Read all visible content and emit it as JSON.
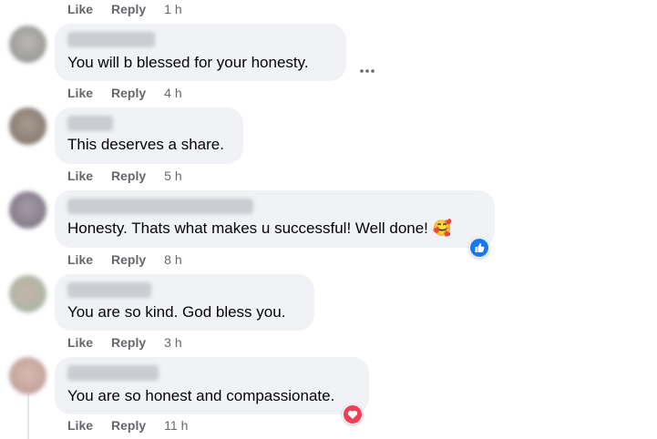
{
  "colors": {
    "bubble_bg": "#f0f2f5",
    "meta_text": "#65676b",
    "body_text": "#050505",
    "like_blue": "#1877f2",
    "love_red": "#f33e58"
  },
  "top_actions": {
    "like": "Like",
    "reply": "Reply",
    "time": "1 h"
  },
  "comments": [
    {
      "text": "You will b blessed for your honesty.",
      "like": "Like",
      "reply": "Reply",
      "time": "4 h",
      "reaction": null
    },
    {
      "text": "This deserves a share.",
      "like": "Like",
      "reply": "Reply",
      "time": "5 h",
      "reaction": null
    },
    {
      "text": "Honesty. Thats what makes u successful! Well done! 🥰",
      "like": "Like",
      "reply": "Reply",
      "time": "8 h",
      "reaction": "like-reaction-icon"
    },
    {
      "text": "You are so kind. God bless you.",
      "like": "Like",
      "reply": "Reply",
      "time": "3 h",
      "reaction": null
    },
    {
      "text": "You are so honest and compassionate.",
      "like": "Like",
      "reply": "Reply",
      "time": "11 h",
      "reaction": "love-reaction-icon"
    }
  ],
  "icons": {
    "more": "more-options-icon",
    "like_reaction": "like-reaction-icon",
    "love_reaction": "love-reaction-icon"
  }
}
